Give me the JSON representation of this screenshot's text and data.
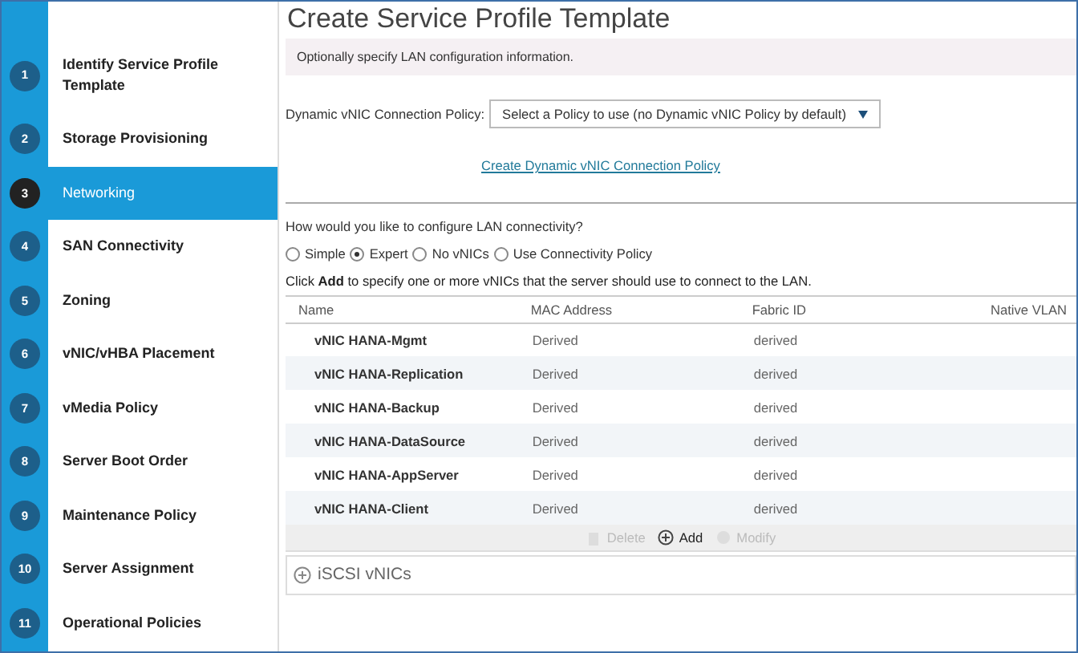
{
  "steps": [
    {
      "number": "1",
      "label": "Identify Service Profile Template",
      "selected": false
    },
    {
      "number": "2",
      "label": "Storage Provisioning",
      "selected": false
    },
    {
      "number": "3",
      "label": "Networking",
      "selected": true
    },
    {
      "number": "4",
      "label": "SAN Connectivity",
      "selected": false
    },
    {
      "number": "5",
      "label": "Zoning",
      "selected": false
    },
    {
      "number": "6",
      "label": "vNIC/vHBA Placement",
      "selected": false
    },
    {
      "number": "7",
      "label": "vMedia Policy",
      "selected": false
    },
    {
      "number": "8",
      "label": "Server Boot Order",
      "selected": false
    },
    {
      "number": "9",
      "label": "Maintenance Policy",
      "selected": false
    },
    {
      "number": "10",
      "label": "Server Assignment",
      "selected": false
    },
    {
      "number": "11",
      "label": "Operational Policies",
      "selected": false
    }
  ],
  "title": "Create Service Profile Template",
  "info": "Optionally specify LAN configuration information.",
  "policy": {
    "label": "Dynamic vNIC Connection Policy:",
    "value": "Select a Policy to use (no Dynamic vNIC Policy by default)",
    "link": "Create Dynamic vNIC Connection Policy"
  },
  "question": "How would you like to configure LAN connectivity?",
  "options": [
    {
      "label": "Simple",
      "selected": false
    },
    {
      "label": "Expert",
      "selected": true
    },
    {
      "label": "No vNICs",
      "selected": false
    },
    {
      "label": "Use Connectivity Policy",
      "selected": false
    }
  ],
  "hint": "Click **Add** to specify one or more vNICs that the server should use to connect to the LAN.",
  "table": {
    "columns": [
      "Name",
      "MAC Address",
      "Fabric ID",
      "Native VLAN"
    ],
    "rows": [
      [
        "vNIC HANA-Mgmt",
        "Derived",
        "derived"
      ],
      [
        "vNIC HANA-Replication",
        "Derived",
        "derived"
      ],
      [
        "vNIC HANA-Backup",
        "Derived",
        "derived"
      ],
      [
        "vNIC HANA-DataSource",
        "Derived",
        "derived"
      ],
      [
        "vNIC HANA-AppServer",
        "Derived",
        "derived"
      ],
      [
        "vNIC HANA-Client",
        "Derived",
        "derived"
      ]
    ]
  },
  "actions": [
    {
      "kind": "delete",
      "label": "Delete",
      "disabled": true
    },
    {
      "kind": "add",
      "label": "Add",
      "disabled": false
    },
    {
      "kind": "modify",
      "label": "Modify",
      "disabled": true
    }
  ],
  "iscsi": {
    "label": "iSCSI vNICs",
    "expanded": false
  }
}
